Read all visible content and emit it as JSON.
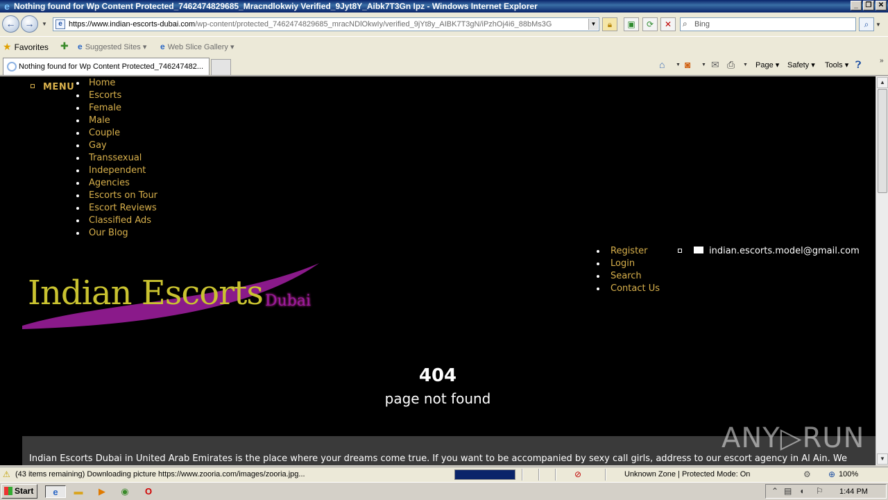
{
  "window": {
    "title": "Nothing found for Wp Content Protected_7462474829685_Mracndlokwiy Verified_9Jyt8Y_Aibk7T3Gn Ipz - Windows Internet Explorer",
    "minimize": "_",
    "restore": "❐",
    "close": "✕"
  },
  "address_bar": {
    "url_host": "https://www.indian-escorts-dubai.com",
    "url_path": "/wp-content/protected_7462474829685_mracNDlOkwIy/verified_9jYt8y_AIBK7T3gN/iPzhOj4i6_88bMs3G"
  },
  "search": {
    "placeholder": "Bing"
  },
  "favorites_bar": {
    "favorites_label": "Favorites",
    "suggested_sites": "Suggested Sites",
    "web_slice_gallery": "Web Slice Gallery"
  },
  "tabs": [
    {
      "label": "Nothing found for Wp Content Protected_746247482..."
    }
  ],
  "command_bar": {
    "page": "Page",
    "safety": "Safety",
    "tools": "Tools"
  },
  "site": {
    "menu_label": "MENU",
    "nav": [
      "Home",
      "Escorts",
      "Female",
      "Male",
      "Couple",
      "Gay",
      "Transsexual",
      "Independent",
      "Agencies",
      "Escorts on Tour",
      "Escort Reviews",
      "Classified Ads",
      "Our Blog"
    ],
    "logo_main": "Indian Escorts",
    "logo_sub": "Dubai",
    "account_links": [
      "Register",
      "Login",
      "Search",
      "Contact Us"
    ],
    "email": "indian.escorts.model@gmail.com",
    "error_code": "404",
    "error_text": "page not found",
    "intro": "Indian Escorts Dubai in United Arab Emirates is the place where your dreams come true. If you want to be accompanied by sexy call girls, address to our escort agency in Al Ain. We",
    "watermark": "ANY▷RUN",
    "colors": {
      "link": "#d9b14c",
      "logo_main": "#c9c230",
      "logo_sub": "#9b1aa0",
      "background": "#000000"
    }
  },
  "status_bar": {
    "message": "(43 items remaining) Downloading picture https://www.zooria.com/images/zooria.jpg...",
    "progress": 1.0,
    "zone": "Unknown Zone | Protected Mode: On",
    "zoom": "100%"
  },
  "taskbar": {
    "start": "Start",
    "clock": "1:44 PM"
  }
}
